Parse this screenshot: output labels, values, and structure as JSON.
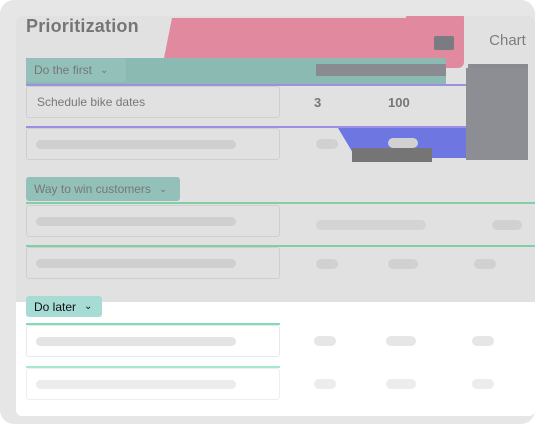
{
  "header": {
    "title": "Prioritization",
    "chart_tab_label": "Chart"
  },
  "groups": [
    {
      "label": "Do the first",
      "rows": [
        {
          "name": "Schedule bike dates",
          "col1": "3",
          "col2": "100"
        },
        {
          "name": ""
        }
      ]
    },
    {
      "label": "Way to win customers",
      "rows": [
        {
          "name": ""
        },
        {
          "name": ""
        }
      ]
    },
    {
      "label": "Do later",
      "rows": [
        {
          "name": ""
        },
        {
          "name": ""
        }
      ]
    }
  ],
  "score_badge": "100",
  "colors": {
    "group_header": "#52b9a9",
    "group_header_light": "#a6dcd4",
    "accent_pink": "#ff3c6c",
    "accent_blue": "#0012ff",
    "accent_purple": "#6a4cff",
    "accent_green": "#2ed47a"
  },
  "icons": [
    "chevron-down-icon"
  ]
}
